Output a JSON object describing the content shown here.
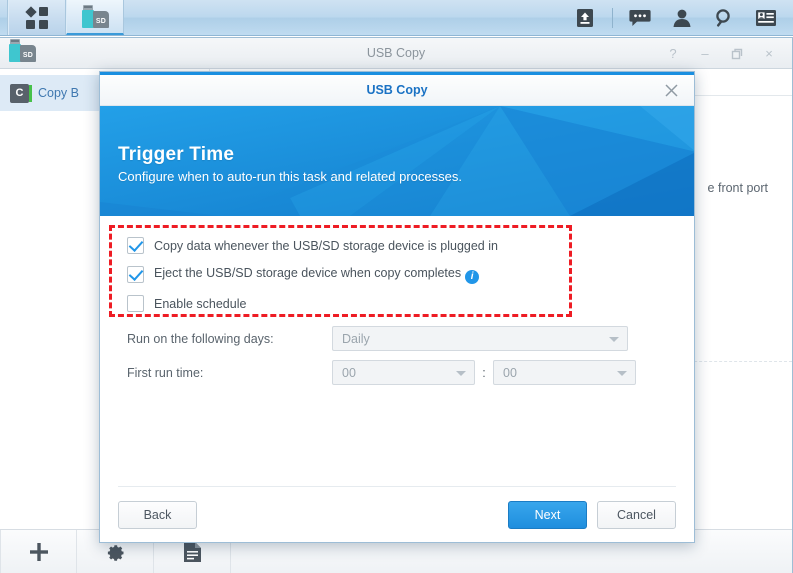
{
  "taskbar": {
    "tabs": [
      {
        "name": "main-menu",
        "icon": "grid-icon"
      },
      {
        "name": "usb-copy-app",
        "icon": "usb-sd-icon",
        "active": true
      }
    ],
    "tray": [
      {
        "name": "upload-icon",
        "glyph": "upload"
      },
      {
        "name": "chat-icon",
        "glyph": "chat"
      },
      {
        "name": "user-icon",
        "glyph": "user"
      },
      {
        "name": "search-icon",
        "glyph": "search"
      },
      {
        "name": "notifications-icon",
        "glyph": "card"
      }
    ]
  },
  "app_window": {
    "title": "USB Copy",
    "icon": "usb-sd-icon",
    "controls": [
      {
        "name": "help",
        "glyph": "?"
      },
      {
        "name": "minimize",
        "glyph": "–"
      },
      {
        "name": "maximize",
        "glyph": "❐"
      },
      {
        "name": "close",
        "glyph": "×"
      }
    ],
    "task_list": [
      {
        "badge": "C",
        "label": "Copy B"
      }
    ],
    "detail_text": "e front port",
    "toolbar": [
      {
        "name": "add-task-button",
        "glyph": "+"
      },
      {
        "name": "settings-button",
        "glyph": "gear"
      },
      {
        "name": "log-button",
        "glyph": "document"
      }
    ]
  },
  "modal": {
    "title": "USB Copy",
    "close_label": "×",
    "banner": {
      "heading": "Trigger Time",
      "subtitle": "Configure when to auto-run this task and related processes."
    },
    "checkboxes": [
      {
        "label": "Copy data whenever the USB/SD storage device is plugged in",
        "checked": true,
        "info": false
      },
      {
        "label": "Eject the USB/SD storage device when copy completes",
        "checked": true,
        "info": true
      },
      {
        "label": "Enable schedule",
        "checked": false,
        "info": false
      }
    ],
    "fields": [
      {
        "label": "Run on the following days:",
        "value": "Daily",
        "disabled": true
      },
      {
        "label": "First run time:",
        "value_hour": "00",
        "value_minute": "00",
        "separator": ":",
        "disabled": true
      }
    ],
    "buttons": {
      "back": "Back",
      "next": "Next",
      "cancel": "Cancel"
    },
    "highlight_color": "#ee1c24"
  }
}
